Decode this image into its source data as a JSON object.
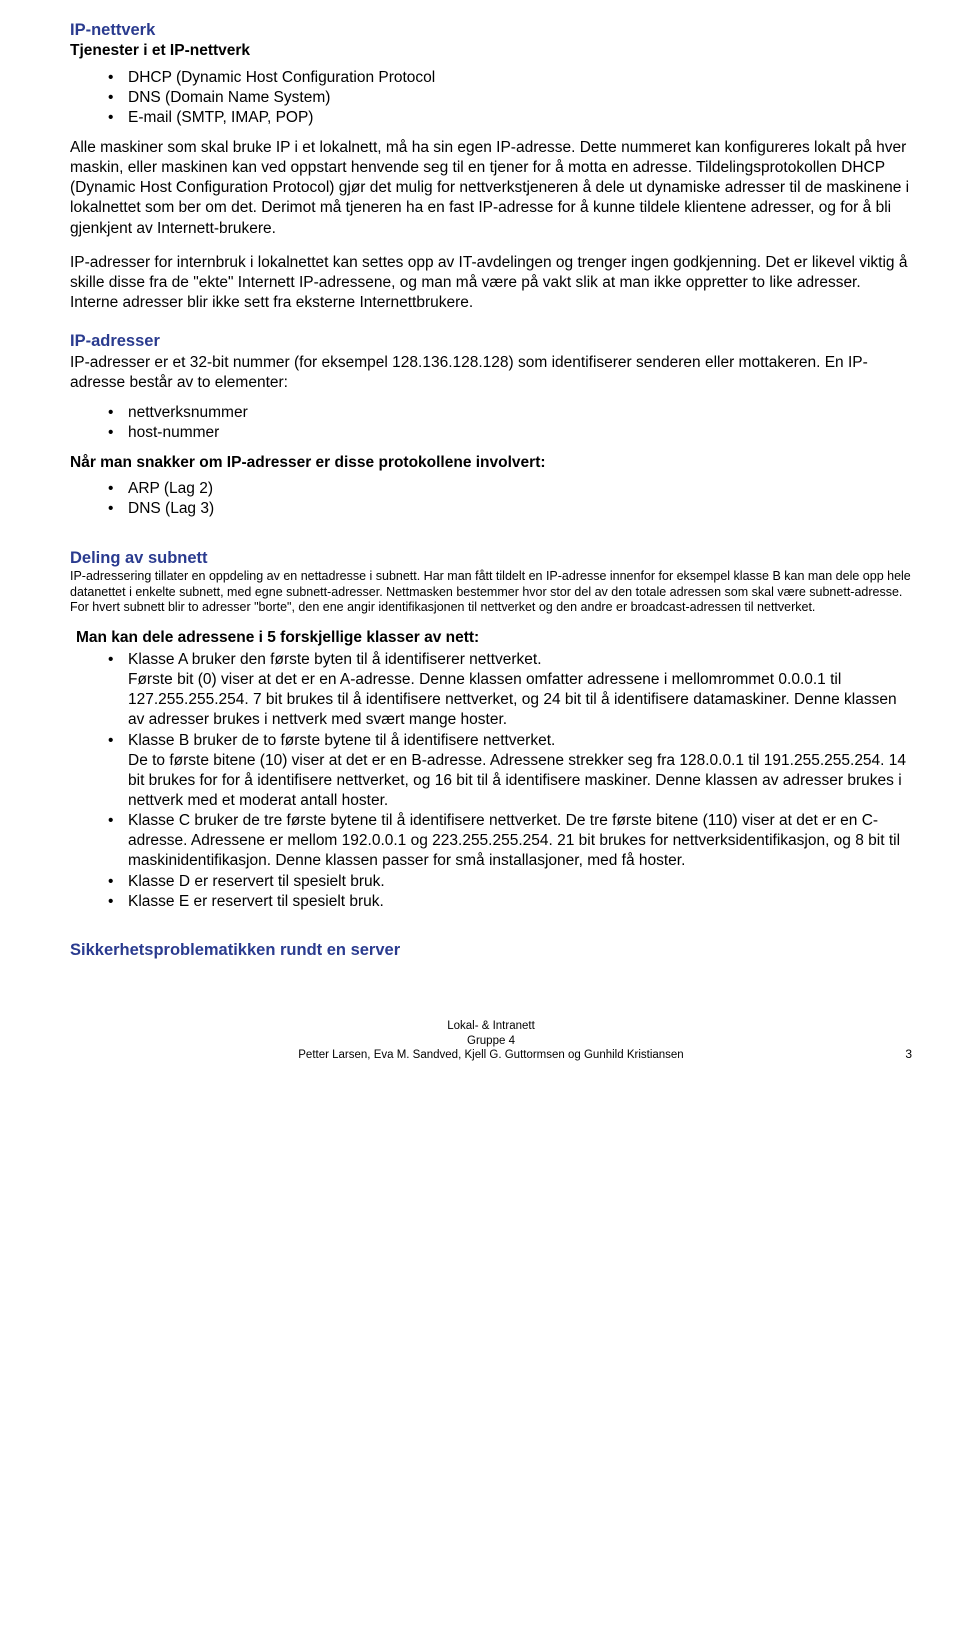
{
  "s1": {
    "h": "IP-nettverk",
    "sub": "Tjenester i et IP-nettverk",
    "items": [
      "DHCP (Dynamic Host Configuration Protocol",
      "DNS (Domain Name System)",
      "E-mail (SMTP, IMAP, POP)"
    ],
    "p1": "Alle maskiner som skal bruke IP i et lokalnett, må ha sin egen IP-adresse. Dette nummeret kan konfigureres lokalt på hver maskin, eller maskinen kan ved oppstart henvende seg til en tjener for å motta en adresse. Tildelingsprotokollen DHCP (Dynamic Host Configuration Protocol) gjør det mulig for nettverkstjeneren å dele ut dynamiske adresser til de maskinene i lokalnettet som ber om det. Derimot må tjeneren ha en fast IP-adresse for å kunne tildele klientene adresser, og for å bli gjenkjent av Internett-brukere.",
    "p2": "IP-adresser for internbruk i lokalnettet kan settes opp av IT-avdelingen og trenger ingen godkjenning. Det er likevel viktig å skille disse fra de \"ekte\" Internett IP-adressene, og man må være på vakt slik at man ikke oppretter to like adresser. Interne adresser blir ikke sett fra eksterne Internettbrukere."
  },
  "s2": {
    "h": "IP-adresser",
    "p1": "IP-adresser er et 32-bit nummer (for eksempel 128.136.128.128) som identifiserer senderen eller mottakeren. En IP-adresse består av to elementer:",
    "items1": [
      "nettverksnummer",
      "host-nummer"
    ],
    "sub2": "Når man snakker om IP-adresser er disse protokollene involvert:",
    "items2": [
      "ARP (Lag 2)",
      "DNS (Lag 3)"
    ]
  },
  "s3": {
    "h": "Deling av subnett",
    "small": "IP-adressering tillater en oppdeling av en nettadresse i subnett. Har man fått tildelt en IP-adresse innenfor for eksempel klasse B kan man dele opp hele datanettet i enkelte subnett, med egne subnett-adresser. Nettmasken bestemmer hvor stor del av den totale adressen som skal være subnett-adresse. For hvert subnett blir to adresser \"borte\", den ene angir identifikasjonen til nettverket og den andre er broadcast-adressen til nettverket.",
    "sub": "Man kan dele adressene i 5 forskjellige klasser av nett:",
    "items": [
      "Klasse A bruker den første byten til å identifiserer nettverket.\nFørste bit (0) viser at det er en A-adresse. Denne klassen omfatter adressene i mellomrommet 0.0.0.1 til 127.255.255.254. 7 bit brukes til å identifisere nettverket, og 24 bit til å identifisere datamaskiner. Denne klassen av adresser brukes i nettverk med svært mange hoster.",
      "Klasse B bruker de to første bytene til å identifisere nettverket.\nDe to første bitene (10) viser at det er en B-adresse. Adressene strekker seg fra 128.0.0.1 til 191.255.255.254. 14 bit brukes for for å identifisere nettverket, og 16 bit til å identifisere maskiner. Denne klassen av adresser brukes i nettverk med et moderat antall hoster.",
      "Klasse C bruker de tre første bytene til å identifisere nettverket.  De tre første bitene (110) viser at det er en C-adresse. Adressene er mellom 192.0.0.1 og 223.255.255.254. 21 bit brukes for nettverksidentifikasjon, og 8 bit til maskinidentifikasjon. Denne klassen passer for små installasjoner, med få hoster.",
      "Klasse D er reservert til spesielt bruk.",
      "Klasse E er reservert til spesielt bruk."
    ]
  },
  "s4": {
    "h": "Sikkerhetsproblematikken rundt en server"
  },
  "footer": {
    "l1": "Lokal- & Intranett",
    "l2": "Gruppe 4",
    "l3": "Petter Larsen, Eva M. Sandved, Kjell G. Guttormsen og Gunhild Kristiansen",
    "pg": "3"
  }
}
